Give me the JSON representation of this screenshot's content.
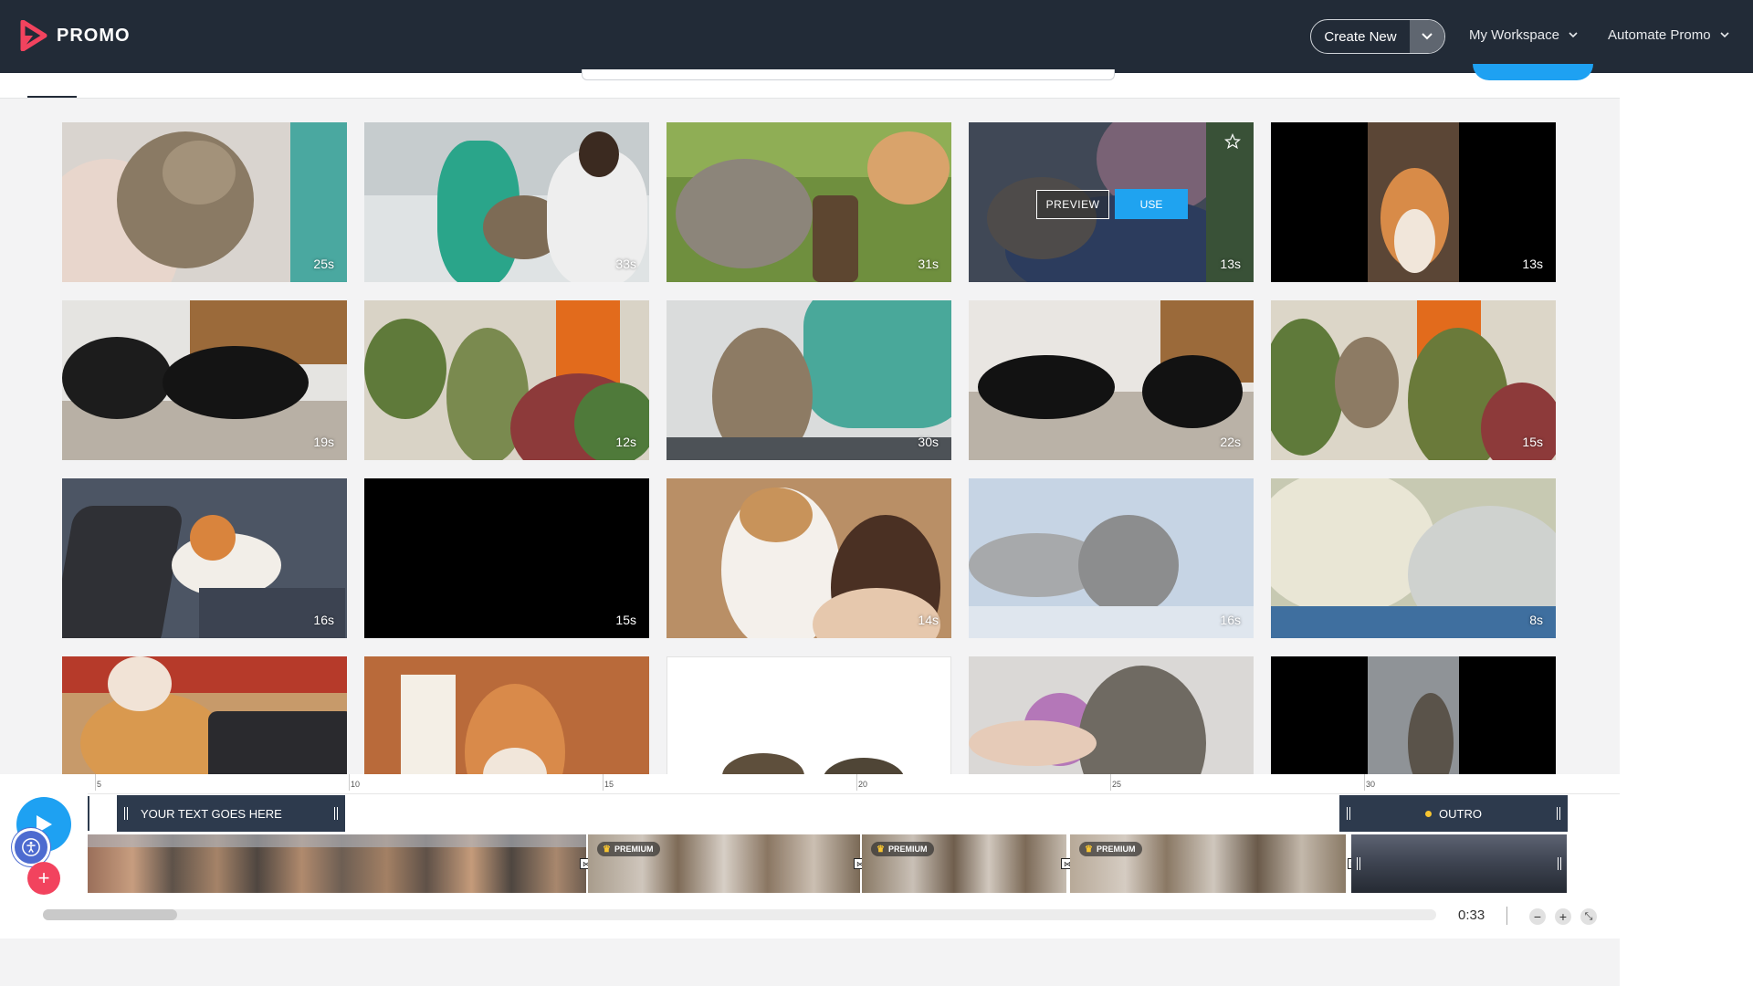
{
  "header": {
    "brand": "PROMO",
    "create_new": "Create New",
    "nav": [
      {
        "label": "My Workspace"
      },
      {
        "label": "Automate Promo"
      }
    ]
  },
  "tiles": [
    {
      "duration": "25s"
    },
    {
      "duration": "33s"
    },
    {
      "duration": "31s"
    },
    {
      "duration": "13s",
      "preview": "PREVIEW",
      "use": "USE"
    },
    {
      "duration": "13s"
    },
    {
      "duration": "19s"
    },
    {
      "duration": "12s"
    },
    {
      "duration": "30s"
    },
    {
      "duration": "22s"
    },
    {
      "duration": "15s"
    },
    {
      "duration": "16s"
    },
    {
      "duration": "15s"
    },
    {
      "duration": "14s"
    },
    {
      "duration": "16s"
    },
    {
      "duration": "8s"
    },
    {
      "duration": ""
    },
    {
      "duration": ""
    },
    {
      "duration": ""
    },
    {
      "duration": ""
    },
    {
      "duration": ""
    }
  ],
  "timeline": {
    "ticks": [
      "5",
      "10",
      "15",
      "20",
      "25",
      "30"
    ],
    "text_track": "YOUR TEXT GOES HERE",
    "outro_track": "OUTRO",
    "premium_label": "PREMIUM",
    "time": "0:33"
  },
  "colors": {
    "header_bg": "#222b37",
    "accent": "#1ea1f2",
    "add": "#f2435e",
    "premium_crown": "#f7c531"
  }
}
